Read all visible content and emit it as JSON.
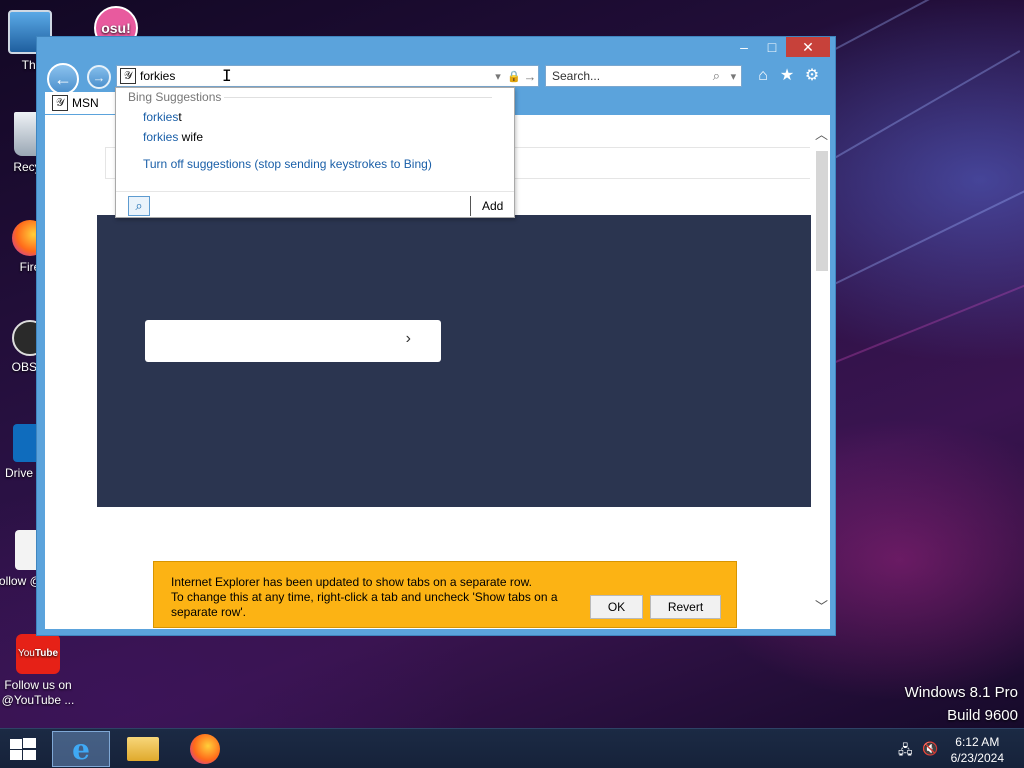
{
  "desktop": {
    "icons": [
      {
        "label": "Thi",
        "icon": "this-pc-icon"
      },
      {
        "label": "osu!",
        "icon": "osu-icon"
      },
      {
        "label": "Recyc",
        "icon": "recycle-bin-icon"
      },
      {
        "label": "Fire",
        "icon": "firefox-icon"
      },
      {
        "label": "OBS S",
        "icon": "obs-icon"
      },
      {
        "label": "Drive Por",
        "icon": "drive-icon"
      },
      {
        "label": "Follow @Face",
        "icon": "facebook-icon"
      },
      {
        "label": "Follow us on @YouTube ...",
        "icon": "youtube-icon"
      }
    ],
    "watermark": {
      "line1": "Windows 8.1 Pro",
      "line2": "Build 9600"
    }
  },
  "window": {
    "controls": {
      "minimize": "–",
      "maximize": "□",
      "close": "✕"
    }
  },
  "toolbar": {
    "address_value": "forkies",
    "search_placeholder": "Search...",
    "back_glyph": "←",
    "forward_glyph": "→"
  },
  "tabs": [
    {
      "label": "MSN"
    }
  ],
  "suggestions": {
    "header": "Bing Suggestions",
    "items": [
      {
        "typed": "forkies",
        "rest": "t"
      },
      {
        "typed": "forkies",
        "rest": " wife"
      }
    ],
    "turn_off": "Turn off suggestions (stop sending keystrokes to Bing)",
    "add_label": "Add"
  },
  "notification": {
    "line1": "Internet Explorer has been updated to show tabs on a separate row.",
    "line2": "To change this at any time, right-click a tab and uncheck 'Show tabs on a separate row'.",
    "ok_label": "OK",
    "revert_label": "Revert"
  },
  "taskbar": {
    "time": "6:12 AM",
    "date": "6/23/2024"
  },
  "colors": {
    "window_frame": "#5ba3dc",
    "close_button": "#c7413a",
    "notification_bg": "#fcb314",
    "hero_bg": "#2b3550",
    "link": "#1a5fa8"
  }
}
